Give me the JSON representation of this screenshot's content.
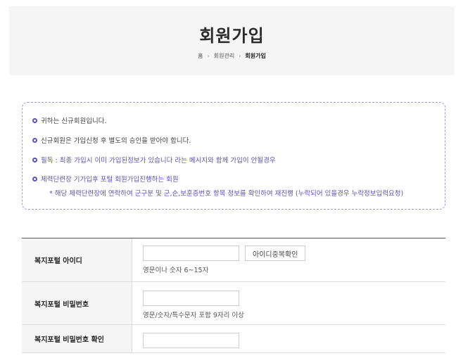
{
  "header": {
    "title": "회원가입",
    "breadcrumb": [
      "홈",
      "회원관리",
      "회원가입"
    ],
    "separator": "›"
  },
  "notice": {
    "items": [
      {
        "text": "귀하는 신규회원입니다.",
        "color": "#444444"
      },
      {
        "text": "신규회원은 가입신청 후 별도의 승인을 받아야 합니다.",
        "color": "#444444"
      },
      {
        "text": "필독 : 최종 가입시 이미 가입된정보가 있습니다 라는 메시지와 함께 가입이 안될경우",
        "color": "#5a53b6"
      },
      {
        "text": "체력단련장 기가입후 포털 회원가입진행하는 회원",
        "color": "#5a53b6"
      }
    ],
    "sub_text": "* 해당 체력단련장에 연락하여 군구분 및 군,순,보훈증번호 항목 정보를 확인하여 재진행 (누락되어 있을경우 누락정보입력요청)"
  },
  "form": {
    "rows": [
      {
        "label": "복지포털 아이디",
        "value": "",
        "hint": "영문이나 숫자 6~15자",
        "button": "아이디중복확인"
      },
      {
        "label": "복지포털 비밀번호",
        "value": "",
        "hint": "영문/숫자/특수문자 포함 9자리 이상"
      },
      {
        "label": "복지포털 비밀번호 확인",
        "value": ""
      }
    ]
  },
  "colors": {
    "accent": "#5a53b6",
    "header_bg": "#f5f5f5",
    "label_bg": "#f5f5f5"
  }
}
